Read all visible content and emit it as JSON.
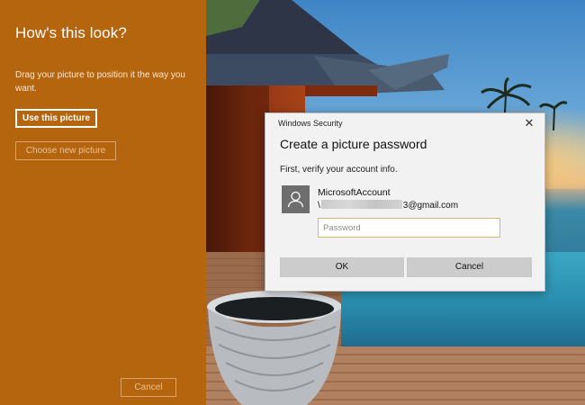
{
  "side_panel": {
    "title": "How's this look?",
    "instructions": "Drag your picture to position it the way you want.",
    "use_button": "Use this picture",
    "choose_button": "Choose new picture",
    "cancel_button": "Cancel",
    "background_color": "#b5650d"
  },
  "dialog": {
    "caption": "Windows Security",
    "close_icon": "close-icon",
    "heading": "Create a picture password",
    "subtext": "First, verify your account info.",
    "account_name": "MicrosoftAccount",
    "email_prefix": "\\",
    "email_suffix": "3@gmail.com",
    "password_placeholder": "Password",
    "ok_button": "OK",
    "cancel_button": "Cancel",
    "avatar_icon": "user-icon"
  }
}
